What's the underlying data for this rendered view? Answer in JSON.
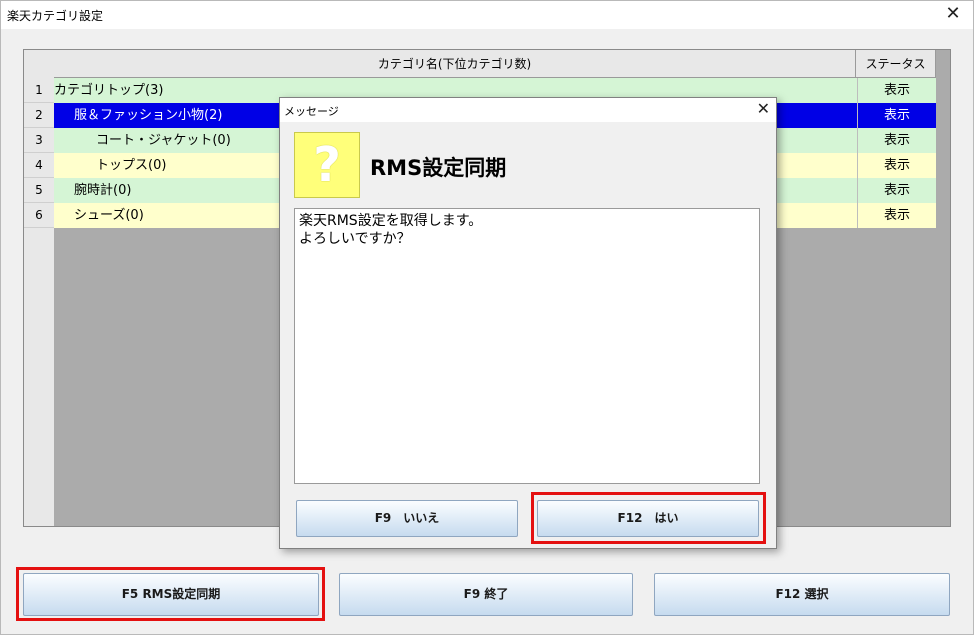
{
  "window": {
    "title": "楽天カテゴリ設定"
  },
  "grid": {
    "columns": {
      "name": "カテゴリ名(下位カテゴリ数)",
      "status": "ステータス"
    },
    "rows": [
      {
        "num": "1",
        "name": "カテゴリトップ(3)",
        "status": "表示"
      },
      {
        "num": "2",
        "name": "服＆ファッション小物(2)",
        "status": "表示"
      },
      {
        "num": "3",
        "name": "コート・ジャケット(0)",
        "status": "表示"
      },
      {
        "num": "4",
        "name": "トップス(0)",
        "status": "表示"
      },
      {
        "num": "5",
        "name": "腕時計(0)",
        "status": "表示"
      },
      {
        "num": "6",
        "name": "シューズ(0)",
        "status": "表示"
      }
    ]
  },
  "buttons": {
    "f5": "F5 RMS設定同期",
    "f9": "F9 終了",
    "f12": "F12 選択"
  },
  "dialog": {
    "title": "メッセージ",
    "icon": "?",
    "heading": "RMS設定同期",
    "message": "楽天RMS設定を取得します。\nよろしいですか？",
    "no_label": "F9　いいえ",
    "yes_label": "F12　はい"
  },
  "colors": {
    "row_green": "#d5f5d5",
    "row_yellow": "#ffffcc",
    "selected": "#0000e6",
    "highlight": "#e41010"
  }
}
